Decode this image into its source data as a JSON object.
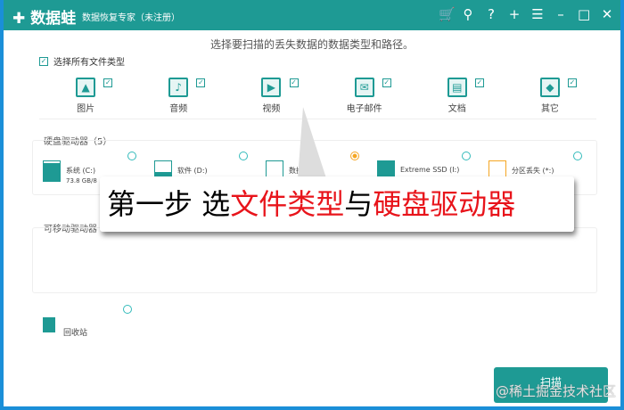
{
  "header": {
    "logo": "✚ 数据蛙",
    "subtitle": "数据恢复专家（未注册）",
    "controls": [
      {
        "name": "cart-icon",
        "glyph": "🛒"
      },
      {
        "name": "key-icon",
        "glyph": "⚲"
      },
      {
        "name": "help-icon",
        "glyph": "?"
      },
      {
        "name": "plus-icon",
        "glyph": "+"
      },
      {
        "name": "menu-icon",
        "glyph": "☰"
      },
      {
        "name": "minimize-icon",
        "glyph": "–"
      },
      {
        "name": "maximize-icon",
        "glyph": "□"
      },
      {
        "name": "close-icon",
        "glyph": "✕"
      }
    ]
  },
  "prompt": "选择要扫描的丢失数据的数据类型和路径。",
  "select_all": "选择所有文件类型",
  "types": [
    {
      "label": "图片",
      "icon": "▲"
    },
    {
      "label": "音频",
      "icon": "♪"
    },
    {
      "label": "视频",
      "icon": "▶"
    },
    {
      "label": "电子邮件",
      "icon": "✉"
    },
    {
      "label": "文档",
      "icon": "▤"
    },
    {
      "label": "其它",
      "icon": "◆"
    }
  ],
  "hdd_title": "硬盘驱动器（5）",
  "drives": [
    {
      "name": "系统 (C:)",
      "size": "73.8 GB/8"
    },
    {
      "name": "软件 (D:)",
      "size": ""
    },
    {
      "name": "数据",
      "size": ""
    },
    {
      "name": "Extreme SSD (I:)",
      "size": ""
    },
    {
      "name": "分区丢失 (*:)",
      "size": ""
    }
  ],
  "removable_title": "可移动驱动器",
  "recycle": "回收站",
  "scan": "扫描",
  "callout": {
    "a": "第一步 选",
    "b": "文件类型",
    "c": "与",
    "d": "硬盘驱动器"
  },
  "watermark": "@稀土掘金技术社区"
}
